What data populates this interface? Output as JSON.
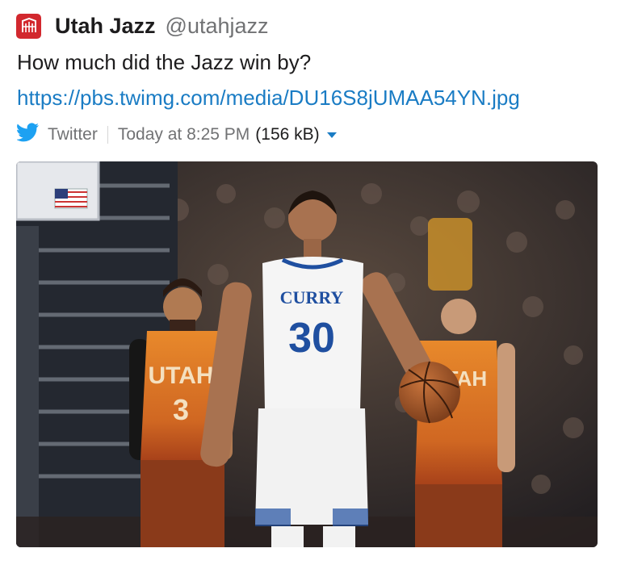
{
  "post": {
    "author": "Utah Jazz",
    "handle": "@utahjazz",
    "message": "How much did the Jazz win by?",
    "link": "https://pbs.twimg.com/media/DU16S8jUMAA54YN.jpg"
  },
  "attachment": {
    "service": "Twitter",
    "time": "Today at 8:25 PM",
    "size": "(156 kB)",
    "icons": [
      "utah-jazz-logo-icon",
      "twitter-bird-icon",
      "caret-down-icon"
    ]
  },
  "photo": {
    "player_center_name": "CURRY",
    "player_center_number": "30",
    "player_left_team": "UTAH",
    "player_left_number": "3",
    "player_right_team": "UTAH",
    "colors": {
      "jazz_orange": "#e07a2a",
      "warriors_blue": "#1f4fa0",
      "link": "#1a7cc4",
      "logo_red": "#d2282e"
    }
  }
}
